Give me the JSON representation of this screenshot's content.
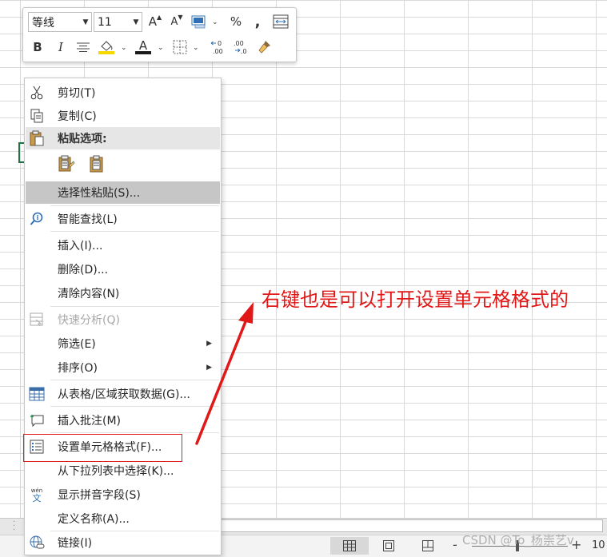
{
  "mini_toolbar": {
    "font_name": "等线",
    "font_size": "11",
    "percent_symbol": "%",
    "comma_symbol": ",",
    "bold": "B",
    "italic": "I",
    "increase_font": "A",
    "decrease_font": "A",
    "font_color_letter": "A",
    "increase_decimal": ".00",
    "decrease_decimal": ".0",
    "fill_color": "#f5d800",
    "font_color": "#c00000"
  },
  "context_menu": {
    "items": [
      {
        "label": "剪切(T)",
        "icon": "scissors-icon"
      },
      {
        "label": "复制(C)",
        "icon": "copy-icon"
      },
      {
        "label": "粘贴选项:",
        "icon": "clipboard-icon"
      },
      {
        "label": "选择性粘贴(S)...",
        "icon": ""
      },
      {
        "label": "智能查找(L)",
        "icon": "smart-lookup-icon"
      },
      {
        "label": "插入(I)...",
        "icon": ""
      },
      {
        "label": "删除(D)...",
        "icon": ""
      },
      {
        "label": "清除内容(N)",
        "icon": ""
      },
      {
        "label": "快速分析(Q)",
        "icon": "quick-analysis-icon"
      },
      {
        "label": "筛选(E)",
        "icon": ""
      },
      {
        "label": "排序(O)",
        "icon": ""
      },
      {
        "label": "从表格/区域获取数据(G)...",
        "icon": "table-icon"
      },
      {
        "label": "插入批注(M)",
        "icon": "comment-icon"
      },
      {
        "label": "设置单元格格式(F)...",
        "icon": "format-cells-icon"
      },
      {
        "label": "从下拉列表中选择(K)...",
        "icon": ""
      },
      {
        "label": "显示拼音字段(S)",
        "icon": "phonetic-icon"
      },
      {
        "label": "定义名称(A)...",
        "icon": ""
      },
      {
        "label": "链接(I)",
        "icon": "link-icon"
      }
    ],
    "phonetic_glyph": "wén\n文"
  },
  "annotation": {
    "text": "右键也是可以打开设置单元格格式的",
    "color": "#e01818"
  },
  "status": {
    "zoom": "10",
    "zoom_minus": "-",
    "zoom_plus": "+"
  },
  "watermark": "CSDN @To_杨崇艺v"
}
